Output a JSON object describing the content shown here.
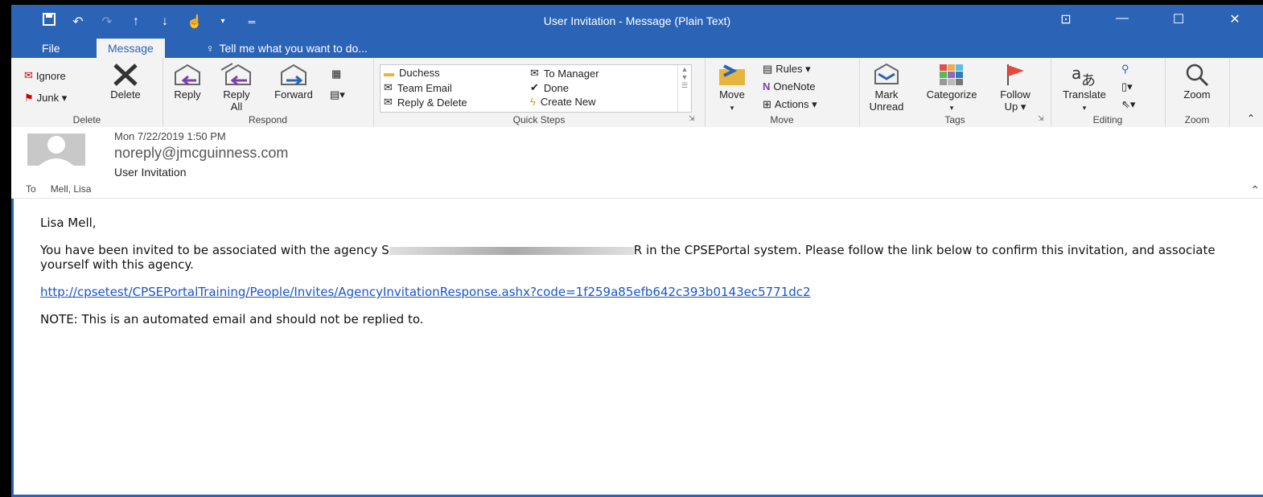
{
  "window": {
    "title": "User Invitation - Message (Plain Text)"
  },
  "tabs": [
    {
      "label": "File"
    },
    {
      "label": "Message"
    }
  ],
  "tell_me": "Tell me what you want to do...",
  "ribbon": {
    "delete_group": {
      "label": "Delete",
      "ignore": "Ignore",
      "junk": "Junk ▾",
      "delete": "Delete"
    },
    "respond_group": {
      "label": "Respond",
      "reply": "Reply",
      "reply_all_1": "Reply",
      "reply_all_2": "All",
      "forward": "Forward"
    },
    "quick_steps": {
      "label": "Quick Steps",
      "items": [
        "Duchess",
        "To Manager",
        "Team Email",
        "Done",
        "Reply & Delete",
        "Create New"
      ]
    },
    "move_group": {
      "label": "Move",
      "move": "Move",
      "rules": "Rules ▾",
      "onenote": "OneNote",
      "actions": "Actions ▾"
    },
    "tags_group": {
      "label": "Tags",
      "mark_1": "Mark",
      "mark_2": "Unread",
      "categorize": "Categorize",
      "follow_1": "Follow",
      "follow_2": "Up ▾"
    },
    "editing_group": {
      "label": "Editing",
      "translate": "Translate"
    },
    "zoom_group": {
      "label": "Zoom",
      "zoom": "Zoom"
    }
  },
  "message": {
    "date": "Mon 7/22/2019 1:50 PM",
    "from": "noreply@jmcguinness.com",
    "subject": "User Invitation",
    "to_label": "To",
    "to": "Mell, Lisa",
    "greeting": "Lisa Mell,",
    "body_before": "You have been invited to be associated with the agency S",
    "body_after": "R in the CPSEPortal system. Please follow the link below to confirm this invitation, and associate yourself with this agency.",
    "link": "http://cpsetest/CPSEPortalTraining/People/Invites/AgencyInvitationResponse.ashx?code=1f259a85efb642c393b0143ec5771dc2",
    "note": "NOTE: This is an automated email and should not be replied to."
  },
  "colors": {
    "accent": "#2b63b6",
    "ribbon_bg": "#f3f3f3",
    "link": "#1a55c8"
  }
}
